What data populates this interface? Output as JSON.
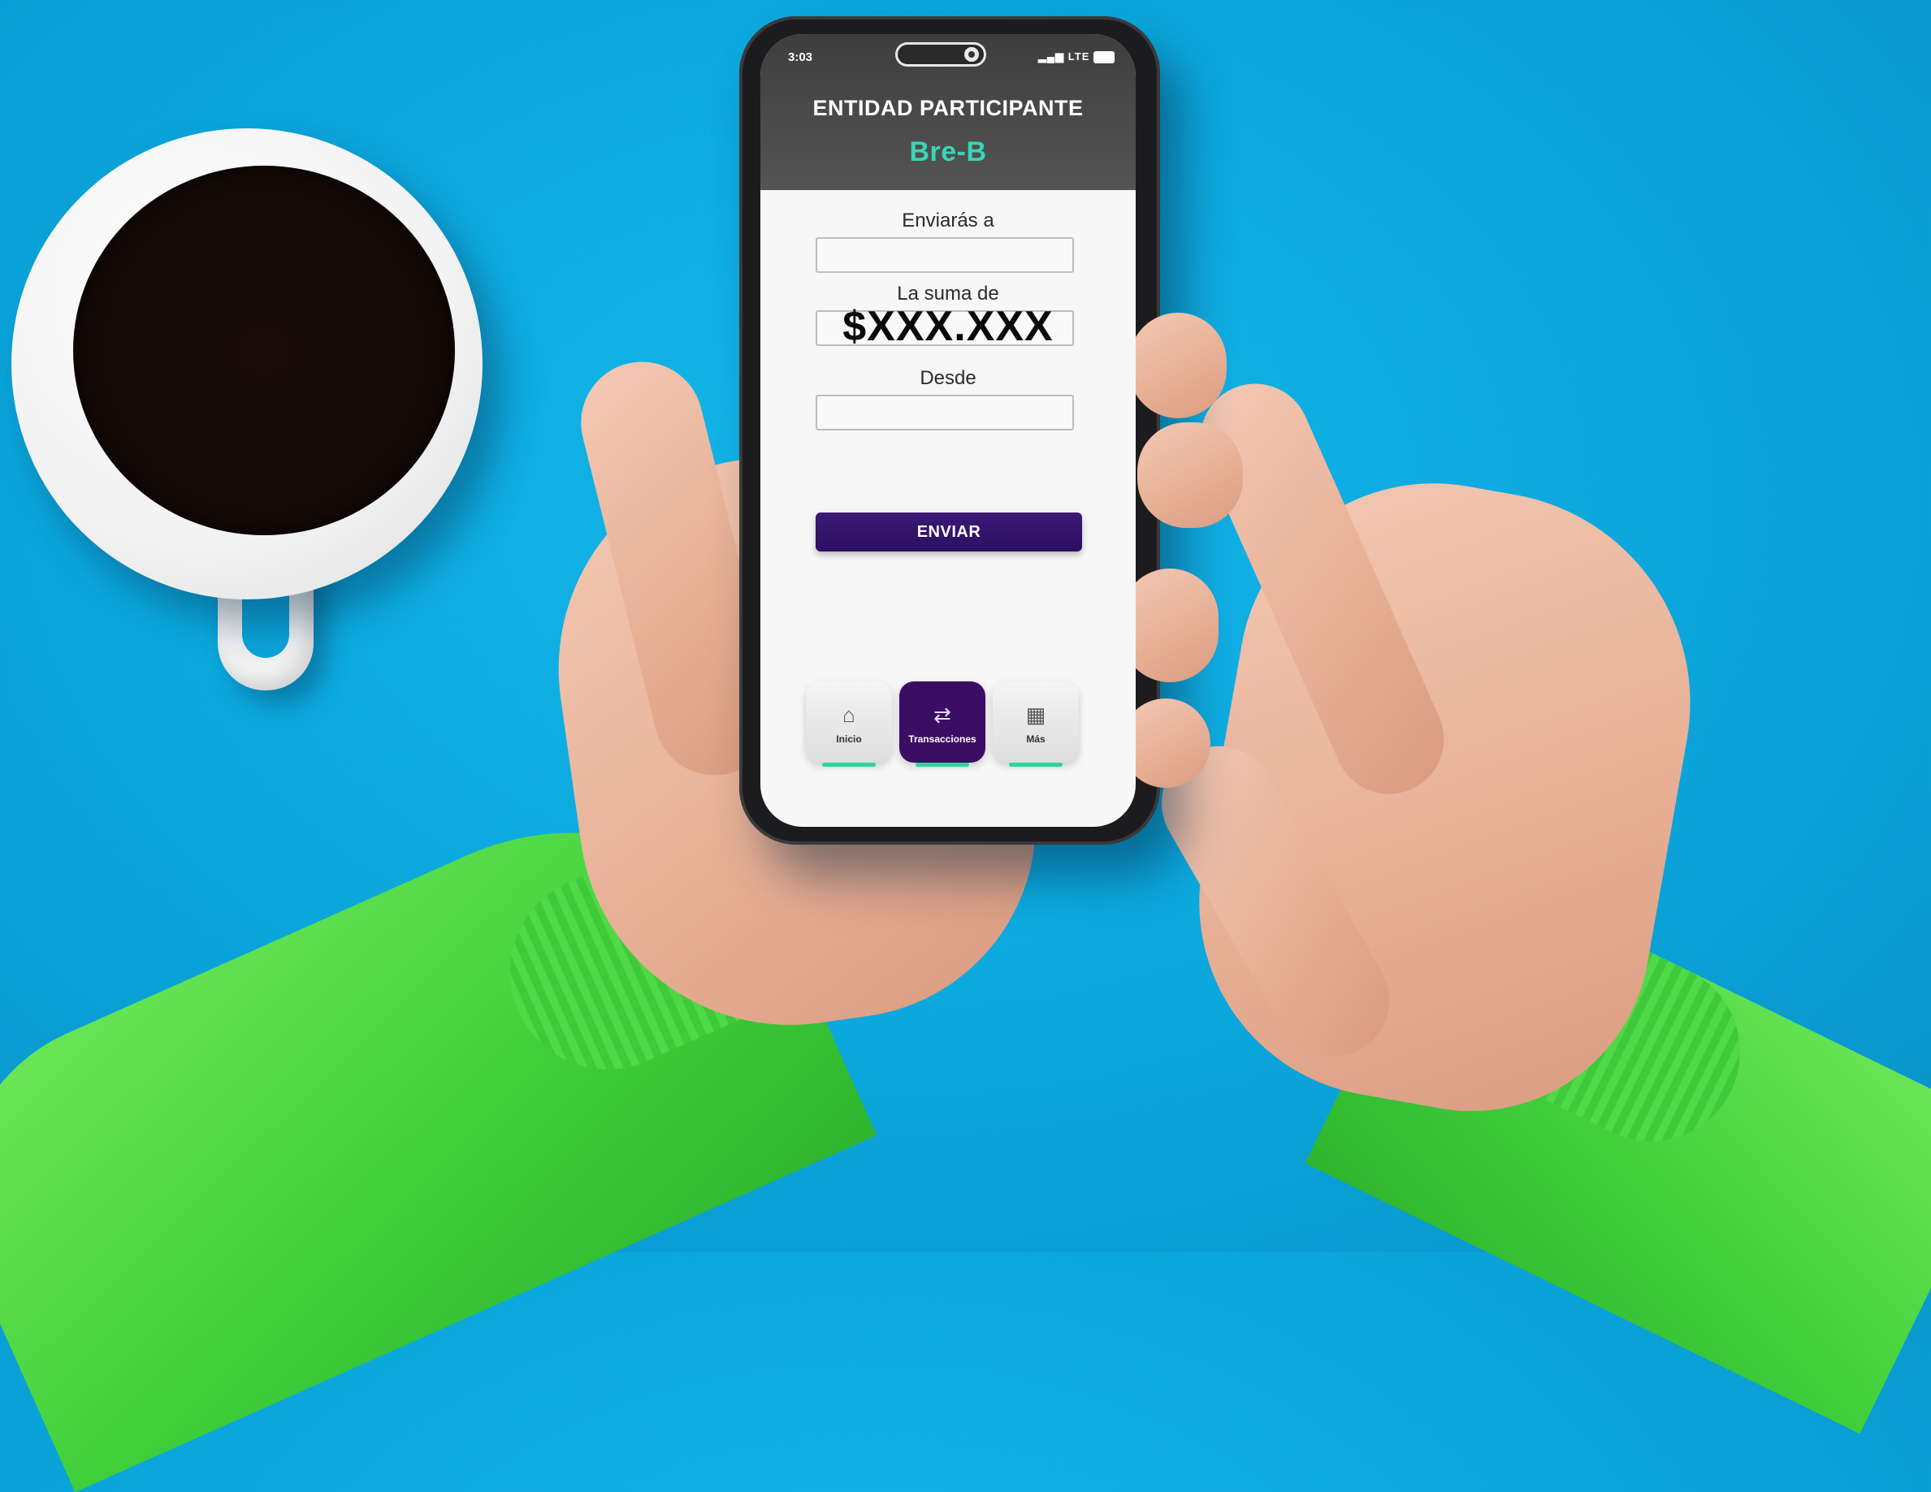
{
  "status_bar": {
    "time": "3:03",
    "network": "LTE"
  },
  "header": {
    "title": "ENTIDAD PARTICIPANTE",
    "brand": "Bre-B"
  },
  "form": {
    "recipient_label": "Enviarás a",
    "recipient_value": "",
    "amount_label": "La suma de",
    "amount_value": "$XXX.XXX",
    "source_label": "Desde",
    "source_value": "",
    "submit_label": "ENVIAR"
  },
  "nav": {
    "items": [
      {
        "label": "Inicio",
        "icon": "home-icon",
        "active": false
      },
      {
        "label": "Transacciones",
        "icon": "money-transfer-icon",
        "active": true
      },
      {
        "label": "Más",
        "icon": "grid-icon",
        "active": false
      }
    ]
  },
  "colors": {
    "background": "#0aa6dc",
    "header": "#4a4a4a",
    "brand": "#38d6b8",
    "primary_button": "#2b0f5e",
    "active_nav": "#3b0d63",
    "nav_indicator": "#2fd39c",
    "sleeve": "#3fce3a"
  }
}
